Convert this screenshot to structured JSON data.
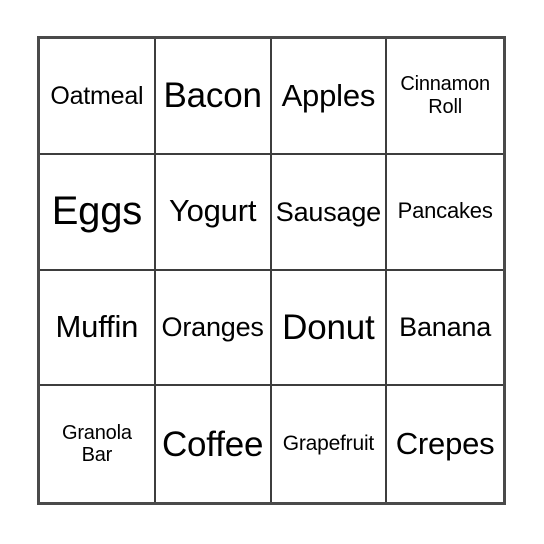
{
  "card": {
    "type": "bingo-card",
    "columns": 4,
    "rows": 4,
    "border_color": "#4a4a4a",
    "grid_line_color": "#3d3d3d",
    "background_color": "#ffffff",
    "text_color": "#000000",
    "cells": [
      {
        "text": "Oatmeal",
        "size": "fs-sm",
        "lines": 1
      },
      {
        "text": "Bacon",
        "size": "fs-xl",
        "lines": 1
      },
      {
        "text": "Apples",
        "size": "fs-lg",
        "lines": 1
      },
      {
        "text": "Cinnamon\nRoll",
        "size": "fs-wrap",
        "lines": 2
      },
      {
        "text": "Eggs",
        "size": "fs-xxl",
        "lines": 1
      },
      {
        "text": "Yogurt",
        "size": "fs-lg",
        "lines": 1
      },
      {
        "text": "Sausage",
        "size": "fs-md",
        "lines": 1
      },
      {
        "text": "Pancakes",
        "size": "fs-xs",
        "lines": 1
      },
      {
        "text": "Muffin",
        "size": "fs-lg",
        "lines": 1
      },
      {
        "text": "Oranges",
        "size": "fs-md",
        "lines": 1
      },
      {
        "text": "Donut",
        "size": "fs-xl",
        "lines": 1
      },
      {
        "text": "Banana",
        "size": "fs-md",
        "lines": 1
      },
      {
        "text": "Granola\nBar",
        "size": "fs-wrap",
        "lines": 2
      },
      {
        "text": "Coffee",
        "size": "fs-xl",
        "lines": 1
      },
      {
        "text": "Grapefruit",
        "size": "fs-xxs",
        "lines": 1
      },
      {
        "text": "Crepes",
        "size": "fs-lg",
        "lines": 1
      }
    ]
  }
}
